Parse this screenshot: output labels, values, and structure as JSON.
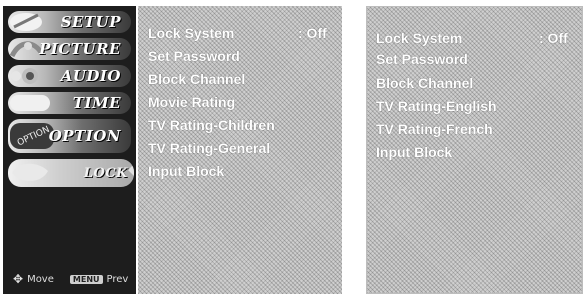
{
  "left_panel": {
    "menu_tabs": [
      {
        "label": "SETUP"
      },
      {
        "label": "PICTURE"
      },
      {
        "label": "AUDIO"
      },
      {
        "label": "TIME"
      },
      {
        "label": "OPTION"
      },
      {
        "label": "LOCK"
      }
    ],
    "active_tab": "LOCK",
    "footer": {
      "move_label": "Move",
      "menu_key": "MENU",
      "prev_label": "Prev"
    },
    "options": [
      {
        "label": "Lock System",
        "value": ": Off"
      },
      {
        "label": "Set Password"
      },
      {
        "label": "Block Channel"
      },
      {
        "label": "Movie Rating"
      },
      {
        "label": "TV Rating-Children"
      },
      {
        "label": "TV Rating-General"
      },
      {
        "label": "Input Block"
      }
    ]
  },
  "right_panel": {
    "options": [
      {
        "label": "Lock System",
        "value": ": Off"
      },
      {
        "label": "Set Password"
      },
      {
        "label": "Block Channel"
      },
      {
        "label": "TV Rating-English"
      },
      {
        "label": "TV Rating-French"
      },
      {
        "label": "Input Block"
      }
    ]
  },
  "colors": {
    "sidebar_bg": "#1d1d1d",
    "panel_bg": "#cfcfcf",
    "text": "#ffffff"
  }
}
